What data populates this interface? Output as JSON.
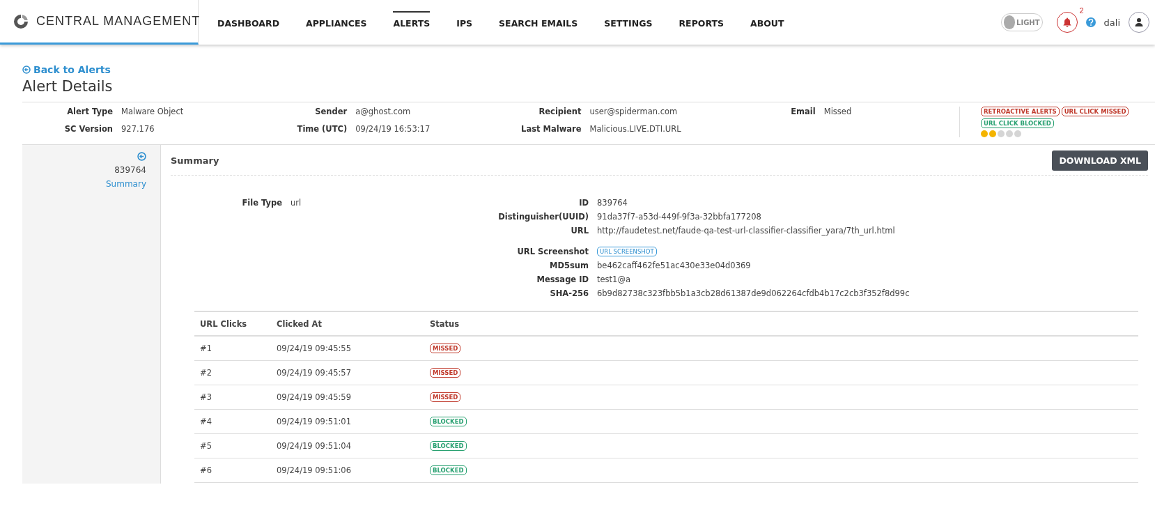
{
  "brand": {
    "name": "CENTRAL MANAGEMENT"
  },
  "nav": [
    {
      "label": "DASHBOARD",
      "selected": false
    },
    {
      "label": "APPLIANCES",
      "selected": false
    },
    {
      "label": "ALERTS",
      "selected": true
    },
    {
      "label": "IPS",
      "selected": false
    },
    {
      "label": "SEARCH EMAILS",
      "selected": false
    },
    {
      "label": "SETTINGS",
      "selected": false
    },
    {
      "label": "REPORTS",
      "selected": false
    },
    {
      "label": "ABOUT",
      "selected": false
    }
  ],
  "header_right": {
    "theme_toggle": {
      "label": "LIGHT",
      "on": false
    },
    "notification_count": "2",
    "user": "dali"
  },
  "back_link": "Back to Alerts",
  "title": "Alert Details",
  "info": [
    {
      "label": "Alert Type",
      "value": "Malware Object"
    },
    {
      "label": "Sender",
      "value": "a@ghost.com"
    },
    {
      "label": "Recipient",
      "value": "user@spiderman.com"
    },
    {
      "label": "Email",
      "value": "Missed"
    },
    {
      "label": "SC Version",
      "value": "927.176"
    },
    {
      "label": "Time (UTC)",
      "value": "09/24/19 16:53:17"
    },
    {
      "label": "Last Malware",
      "value": "Malicious.LIVE.DTI.URL"
    }
  ],
  "tags": [
    {
      "label": "RETROACTIVE ALERTS",
      "color": "#c0392b"
    },
    {
      "label": "URL CLICK MISSED",
      "color": "#c0392b"
    },
    {
      "label": "URL CLICK BLOCKED",
      "color": "#27a070"
    }
  ],
  "severity": {
    "stars": 2
  },
  "sidebar": {
    "id": "839764",
    "items": [
      {
        "label": "Summary",
        "selected": true
      }
    ]
  },
  "section_title": "Summary",
  "download_button": "DOWNLOAD XML",
  "left_fields": [
    {
      "label": "File Type",
      "value": "url"
    }
  ],
  "right_fields": [
    {
      "label": "ID",
      "value": "839764",
      "kind": "text"
    },
    {
      "label": "Distinguisher(UUID)",
      "value": "91da37f7-a53d-449f-9f3a-32bbfa177208",
      "kind": "text"
    },
    {
      "label": "URL",
      "value": "http://faudetest.net/faude-qa-test-url-classifier-classifier_yara/7th_url.html",
      "kind": "text"
    },
    {
      "label": "URL Screenshot",
      "value": "URL SCREENSHOT",
      "kind": "button"
    },
    {
      "label": "MD5sum",
      "value": "be462caff462fe51ac430e33e04d0369",
      "kind": "text"
    },
    {
      "label": "Message ID",
      "value": "test1@a",
      "kind": "text"
    },
    {
      "label": "SHA-256",
      "value": "6b9d82738c323fbb5b1a3cb28d61387de9d062264cfdb4b17c2cb3f352f8d99c",
      "kind": "text"
    }
  ],
  "clicks": {
    "columns": [
      "URL Clicks",
      "Clicked At",
      "Status"
    ],
    "rows": [
      {
        "number": "#1",
        "clicked_at": "09/24/19 09:45:55",
        "status": "MISSED",
        "kind": "missed"
      },
      {
        "number": "#2",
        "clicked_at": "09/24/19 09:45:57",
        "status": "MISSED",
        "kind": "missed"
      },
      {
        "number": "#3",
        "clicked_at": "09/24/19 09:45:59",
        "status": "MISSED",
        "kind": "missed"
      },
      {
        "number": "#4",
        "clicked_at": "09/24/19 09:51:01",
        "status": "BLOCKED",
        "kind": "blocked"
      },
      {
        "number": "#5",
        "clicked_at": "09/24/19 09:51:04",
        "status": "BLOCKED",
        "kind": "blocked"
      },
      {
        "number": "#6",
        "clicked_at": "09/24/19 09:51:06",
        "status": "BLOCKED",
        "kind": "blocked"
      }
    ]
  }
}
